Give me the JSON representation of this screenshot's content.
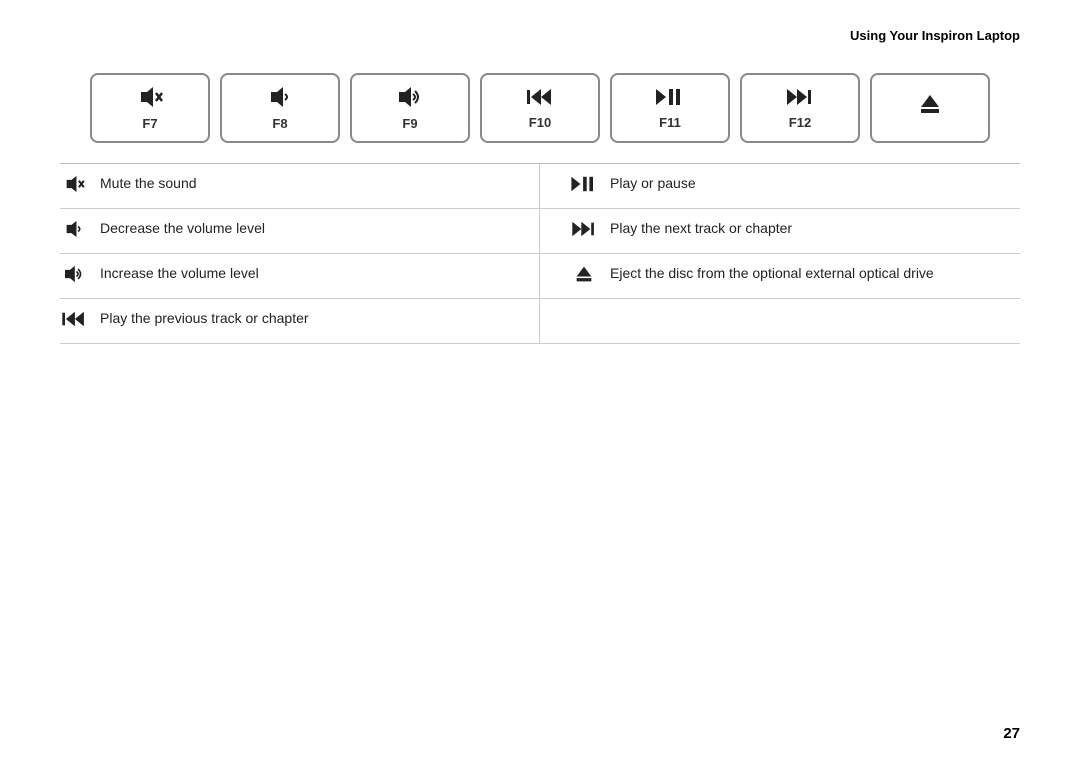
{
  "header": {
    "title": "Using Your Inspiron Laptop"
  },
  "keys": [
    {
      "id": "f7",
      "label": "F7",
      "icon": "🔇"
    },
    {
      "id": "f8",
      "label": "F8",
      "icon": "🔈"
    },
    {
      "id": "f9",
      "label": "F9",
      "icon": "🔊"
    },
    {
      "id": "f10",
      "label": "F10",
      "icon": "⏮"
    },
    {
      "id": "f11",
      "label": "F11",
      "icon": "⏯"
    },
    {
      "id": "f12",
      "label": "F12",
      "icon": "⏭"
    },
    {
      "id": "eject",
      "label": "",
      "icon": "⏏"
    }
  ],
  "descriptions": [
    {
      "icon": "🔇",
      "text": "Mute the sound",
      "side": "left"
    },
    {
      "icon": "▶/II",
      "text": "Play or pause",
      "side": "right"
    },
    {
      "icon": "🔈",
      "text": "Decrease the volume level",
      "side": "left"
    },
    {
      "icon": "▶▶|",
      "text": "Play the next track or chapter",
      "side": "right"
    },
    {
      "icon": "🔊",
      "text": "Increase the volume level",
      "side": "left"
    },
    {
      "icon": "⏏",
      "text": "Eject the disc from the optional external optical drive",
      "side": "right"
    },
    {
      "icon": "|◀◀",
      "text": "Play the previous track or chapter",
      "side": "left"
    },
    {
      "icon": "",
      "text": "",
      "side": "right"
    }
  ],
  "page_number": "27"
}
